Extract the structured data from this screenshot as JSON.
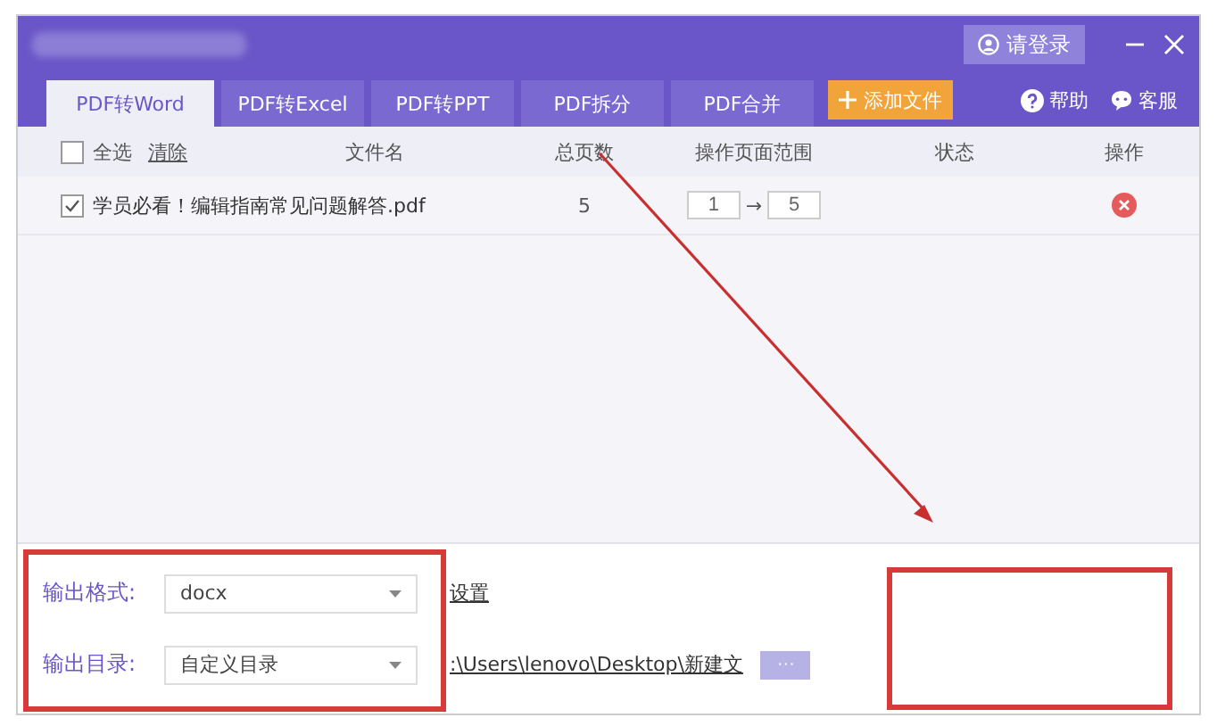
{
  "header": {
    "login_button": "请登录",
    "help": "帮助",
    "service": "客服"
  },
  "tabs": [
    {
      "label": "PDF转Word",
      "selected": true
    },
    {
      "label": "PDF转Excel",
      "selected": false
    },
    {
      "label": "PDF转PPT",
      "selected": false
    },
    {
      "label": "PDF拆分",
      "selected": false
    },
    {
      "label": "PDF合并",
      "selected": false
    }
  ],
  "add_file_button": "添加文件",
  "table": {
    "select_all": {
      "label": "全选",
      "checked": false
    },
    "clear": "清除",
    "columns": [
      "文件名",
      "总页数",
      "操作页面范围",
      "状态",
      "操作"
    ],
    "rows": [
      {
        "checked": true,
        "name": "学员必看！编辑指南常见问题解答.pdf",
        "pages": "5",
        "range_from": "1",
        "arrow": "→",
        "range_to": "5"
      }
    ]
  },
  "output": {
    "format_label": "输出格式:",
    "format_value": "docx",
    "settings_link": "设置",
    "dir_label": "输出目录:",
    "dir_value": "自定义目录",
    "path": ":\\Users\\lenovo\\Desktop\\新建文",
    "browse_button": "···"
  }
}
